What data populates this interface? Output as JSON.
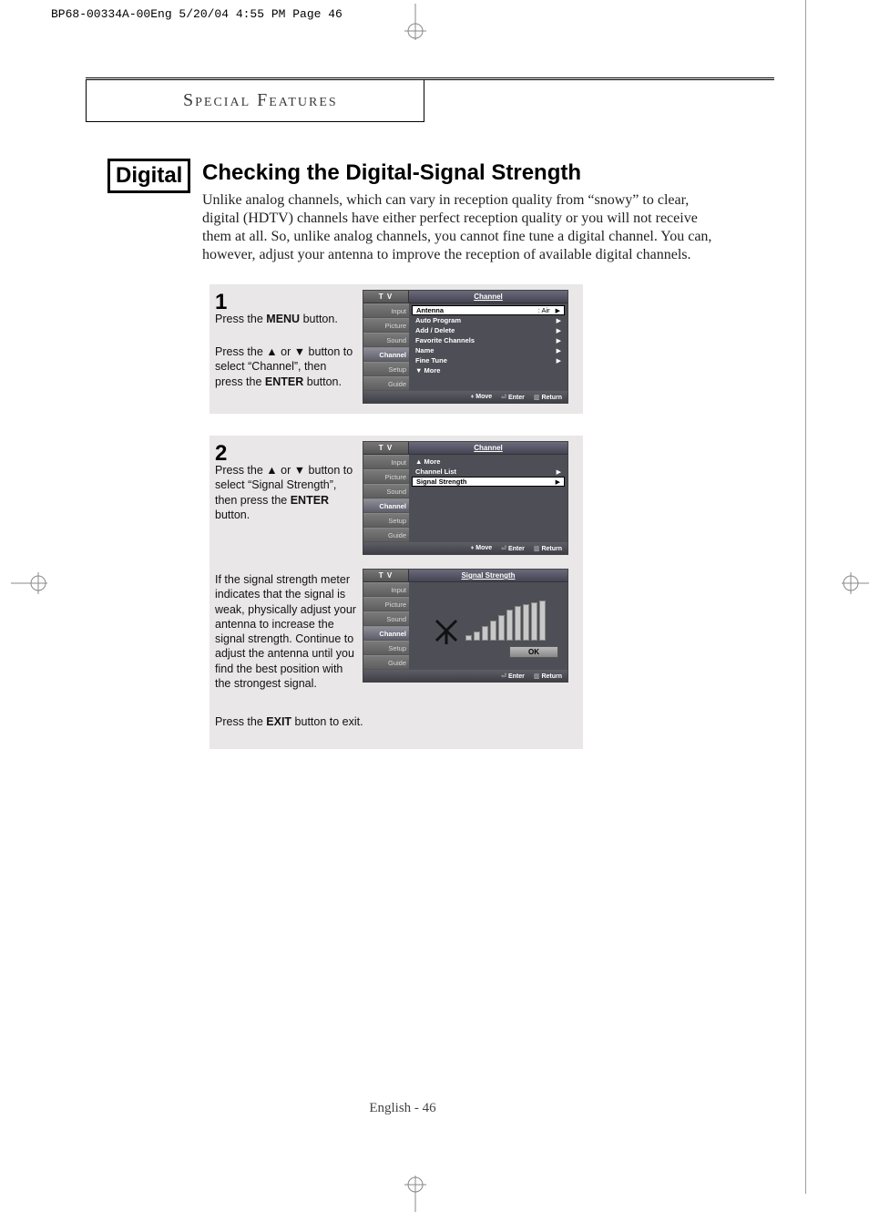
{
  "header_stamp": "BP68-00334A-00Eng  5/20/04  4:55 PM  Page 46",
  "section_title": "Special Features",
  "badge": "Digital",
  "main_heading": "Checking the Digital-Signal Strength",
  "intro": "Unlike analog channels, which can vary in reception quality from “snowy” to clear, digital (HDTV) channels have either perfect reception quality or you will not receive them at all. So, unlike analog channels, you cannot fine tune a digital channel. You can, however, adjust your antenna to improve the reception of available digital channels.",
  "step1": {
    "num": "1",
    "line1a": "Press the ",
    "line1b": "MENU",
    "line1c": " button.",
    "line2a": "Press the ▲ or ▼ button to select “Channel”, then press the ",
    "line2b": "ENTER",
    "line2c": " button."
  },
  "step2": {
    "num": "2",
    "line1a": "Press the ▲ or ▼ button to select “Signal Strength”, then press the ",
    "line1b": "ENTER",
    "line1c": " button.",
    "line2": "If the signal strength meter indicates that the signal is weak, physically adjust your antenna to increase the signal strength. Continue to adjust the antenna until you find the best position with the strongest signal.",
    "line3a": "Press the ",
    "line3b": "EXIT",
    "line3c": " button to exit."
  },
  "osd": {
    "tv": "T V",
    "title_channel": "Channel",
    "title_signal": "Signal Strength",
    "tabs": [
      "Input",
      "Picture",
      "Sound",
      "Channel",
      "Setup",
      "Guide"
    ],
    "menu1": [
      {
        "label": "Antenna",
        "val": ":   Air",
        "boxed": true
      },
      {
        "label": "Auto Program"
      },
      {
        "label": "Add / Delete"
      },
      {
        "label": "Favorite Channels"
      },
      {
        "label": "Name"
      },
      {
        "label": "Fine Tune"
      }
    ],
    "more_down": "▼ More",
    "more_up": "▲ More",
    "menu2": [
      {
        "label": "Channel List"
      },
      {
        "label": "Signal Strength",
        "boxed": true
      }
    ],
    "ok": "OK",
    "foot_move": "Move",
    "foot_enter": "Enter",
    "foot_return": "Return"
  },
  "footer": "English - 46"
}
